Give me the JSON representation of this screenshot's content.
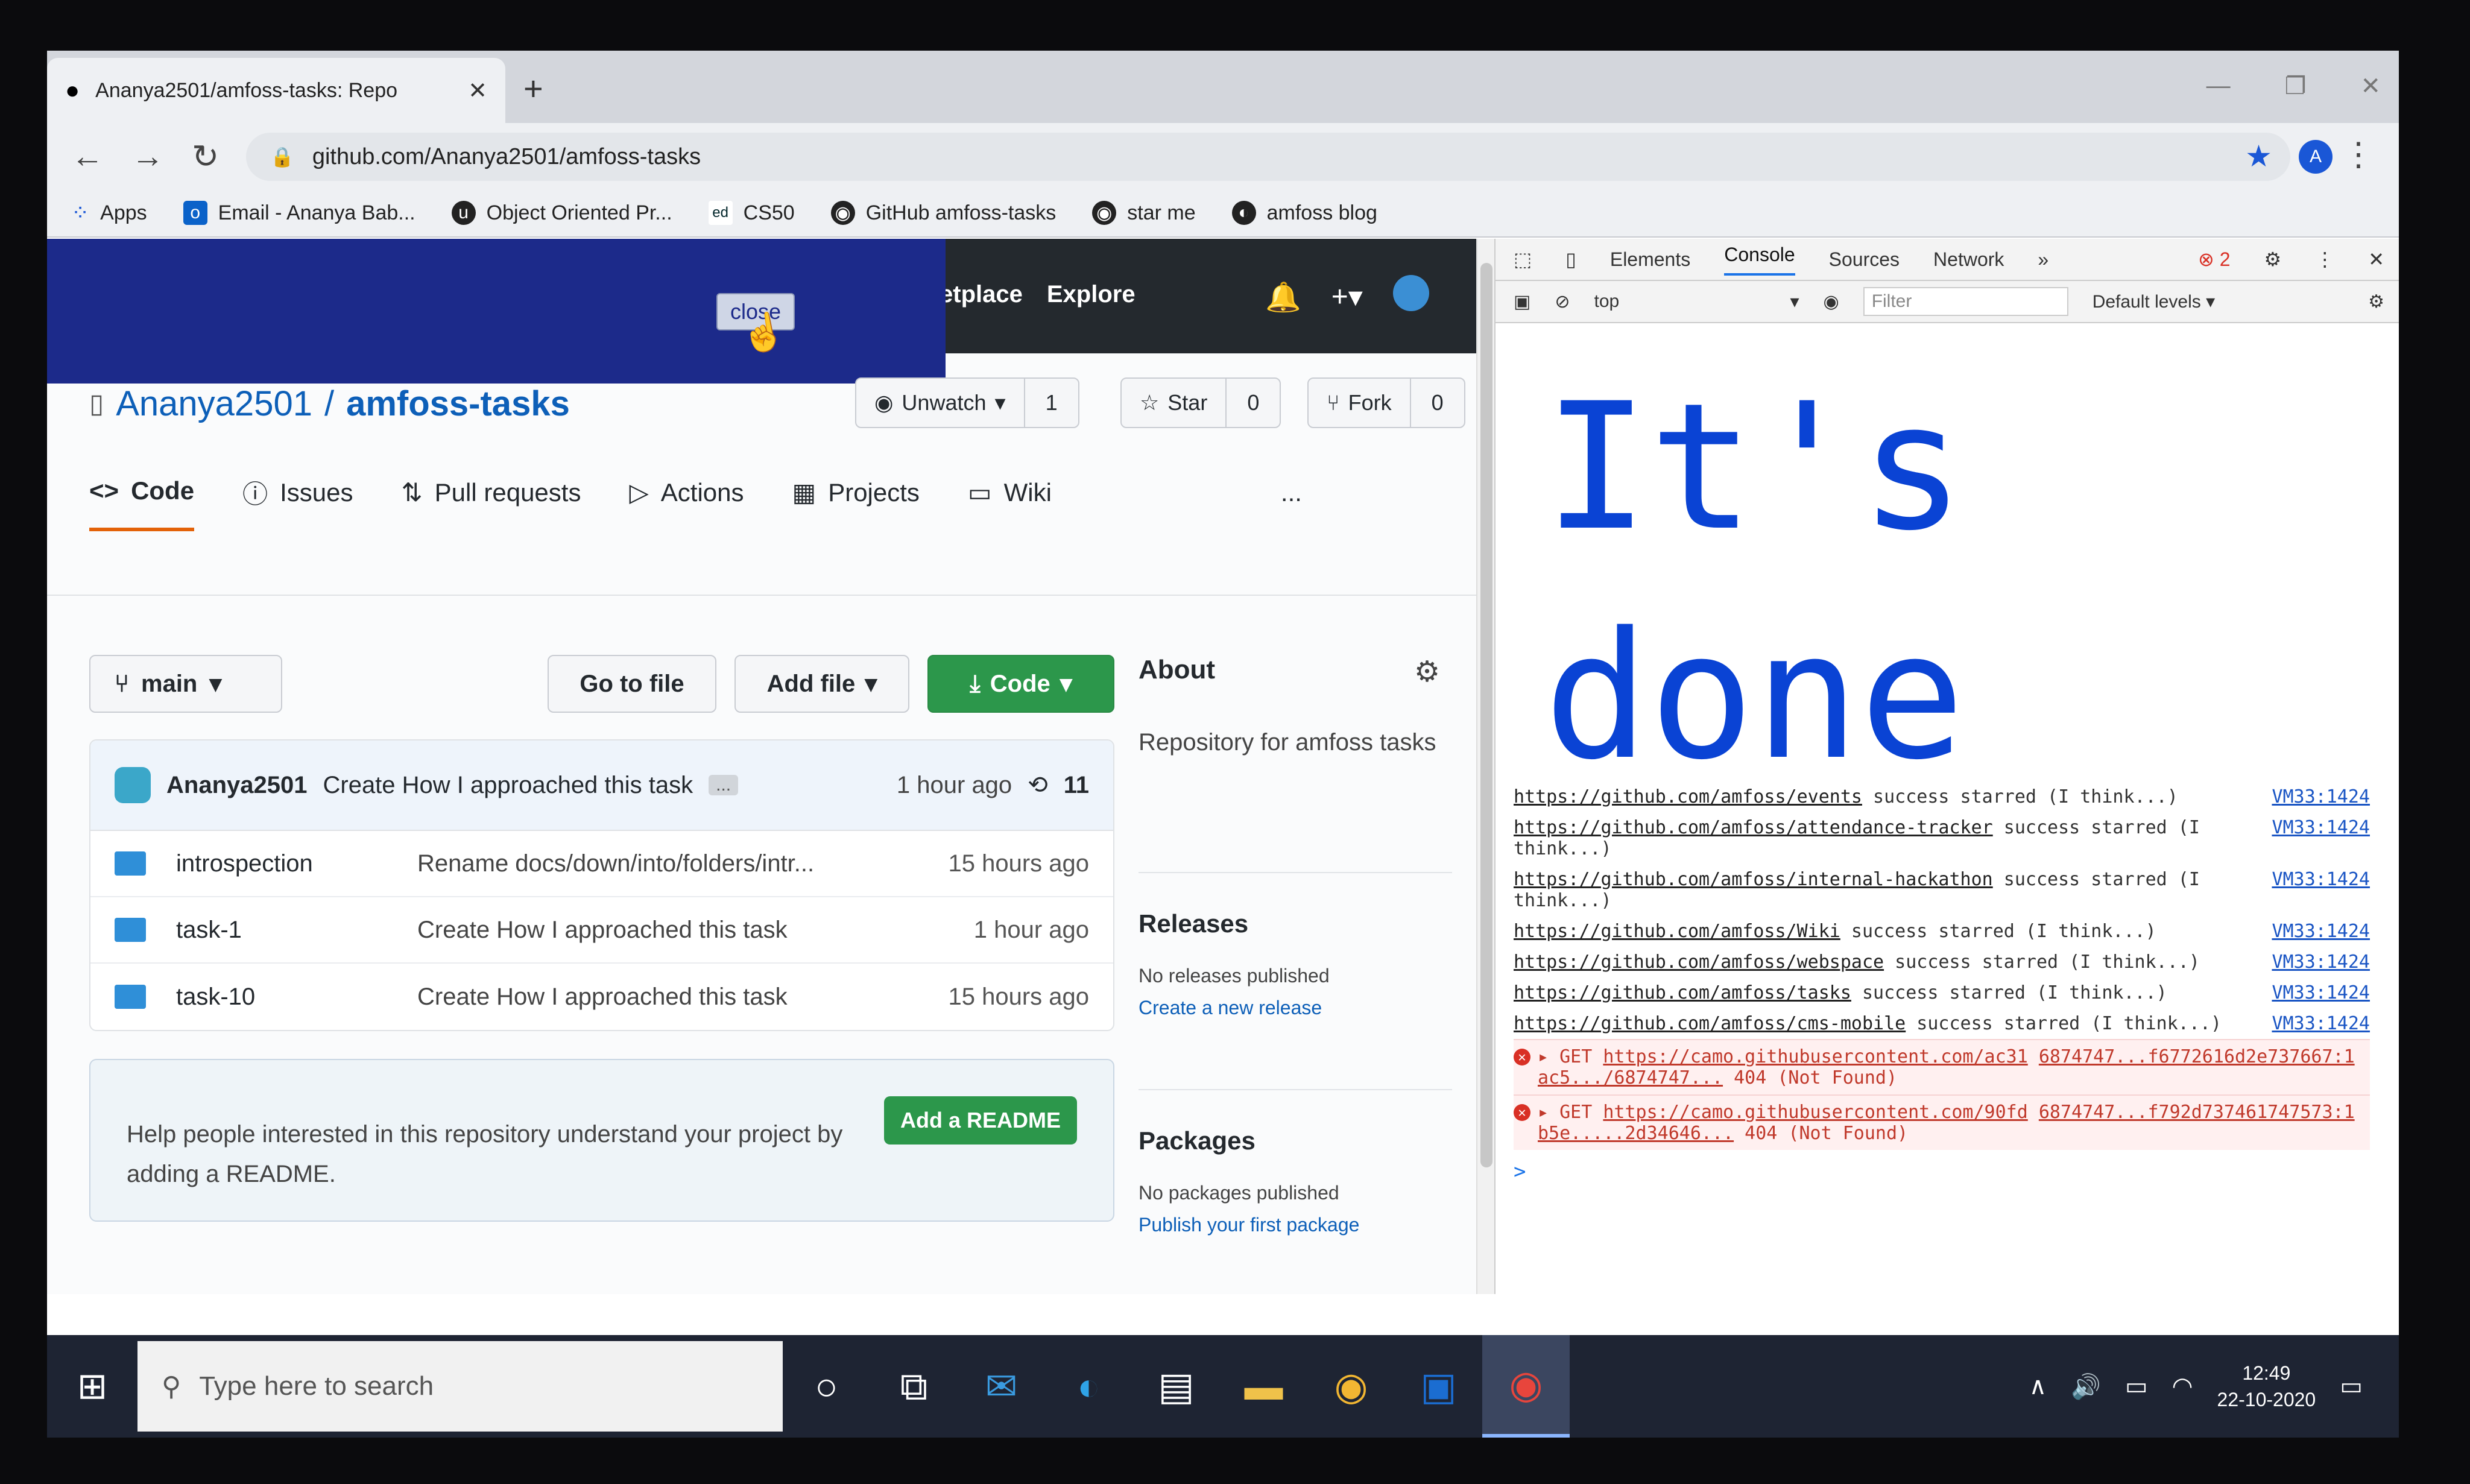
{
  "browser": {
    "tab_title": "Ananya2501/amfoss-tasks: Repo",
    "url": "github.com/Ananya2501/amfoss-tasks",
    "profile_initial": "A",
    "bookmarks": [
      {
        "label": "Apps",
        "icon": "apps-grid-icon"
      },
      {
        "label": "Email - Ananya Bab...",
        "icon": "outlook-icon"
      },
      {
        "label": "Object Oriented Pr...",
        "icon": "udemy-icon"
      },
      {
        "label": "CS50",
        "icon": "edx-icon"
      },
      {
        "label": "GitHub amfoss-tasks",
        "icon": "github-icon"
      },
      {
        "label": "star me",
        "icon": "github-icon"
      },
      {
        "label": "amfoss blog",
        "icon": "blog-icon"
      }
    ]
  },
  "popup": {
    "close_label": "close"
  },
  "header": {
    "menu": [
      "etplace",
      "Explore"
    ]
  },
  "repo": {
    "owner": "Ananya2501",
    "separator": "/",
    "name": "amfoss-tasks",
    "unwatch_label": "Unwatch",
    "watch_count": "1",
    "star_label": "Star",
    "star_count": "0",
    "fork_label": "Fork",
    "fork_count": "0"
  },
  "tabs": [
    {
      "label": "Code",
      "icon": "code-icon"
    },
    {
      "label": "Issues",
      "icon": "issue-icon"
    },
    {
      "label": "Pull requests",
      "icon": "pull-request-icon"
    },
    {
      "label": "Actions",
      "icon": "play-icon"
    },
    {
      "label": "Projects",
      "icon": "project-icon"
    },
    {
      "label": "Wiki",
      "icon": "book-icon"
    }
  ],
  "more_label": "...",
  "file_nav": {
    "branch": "main",
    "go_to_file": "Go to file",
    "add_file": "Add file",
    "code": "Code"
  },
  "commit": {
    "author": "Ananya2501",
    "message": "Create How I approached this task",
    "ellipsis": "...",
    "time": "1 hour ago",
    "count": "11"
  },
  "files": [
    {
      "name": "introspection",
      "message": "Rename docs/down/into/folders/intr...",
      "time": "15 hours ago"
    },
    {
      "name": "task-1",
      "message": "Create How I approached this task",
      "time": "1 hour ago"
    },
    {
      "name": "task-10",
      "message": "Create How I approached this task",
      "time": "15 hours ago"
    }
  ],
  "readme": {
    "text": "Help people interested in this repository understand your project by adding a README.",
    "button": "Add a README"
  },
  "about": {
    "title": "About",
    "description": "Repository for amfoss tasks"
  },
  "releases": {
    "title": "Releases",
    "empty": "No releases published",
    "link": "Create a new release"
  },
  "packages": {
    "title": "Packages",
    "empty": "No packages published",
    "link": "Publish your first package"
  },
  "devtools": {
    "tabs": [
      "Elements",
      "Console",
      "Sources",
      "Network"
    ],
    "more": "»",
    "error_count": "2",
    "context": "top",
    "filter_placeholder": "Filter",
    "levels": "Default levels",
    "big_text": "It's\ndone",
    "logs": [
      {
        "url": "https://github.com/amfoss/events",
        "text": " success starred (I think...)",
        "src": "VM33:1424"
      },
      {
        "url": "https://github.com/amfoss/attendance-tracker",
        "text": " success starred (I think...)",
        "src": "VM33:1424"
      },
      {
        "url": "https://github.com/amfoss/internal-hackathon",
        "text": " success starred (I think...)",
        "src": "VM33:1424"
      },
      {
        "url": "https://github.com/amfoss/Wiki",
        "text": " success starred (I think...)",
        "src": "VM33:1424"
      },
      {
        "url": "https://github.com/amfoss/webspace",
        "text": " success starred (I think...)",
        "src": "VM33:1424"
      },
      {
        "url": "https://github.com/amfoss/tasks",
        "text": " success starred (I think...)",
        "src": "VM33:1424"
      },
      {
        "url": "https://github.com/amfoss/cms-mobile",
        "text": " success starred (I think...)",
        "src": "VM33:1424"
      }
    ],
    "errors": [
      {
        "method": "GET",
        "url": "https://camo.githubusercontent.com/ac31",
        "rest": "6874747...f6772616d2e737667:1",
        "tail": "ac5.../6874747...",
        "status": "404 (Not Found)"
      },
      {
        "method": "GET",
        "url": "https://camo.githubusercontent.com/90fd",
        "rest": "6874747...f792d737461747573:1",
        "tail": "b5e.....2d34646...",
        "status": "404 (Not Found)"
      }
    ],
    "prompt": ">"
  },
  "taskbar": {
    "search_placeholder": "Type here to search",
    "time": "12:49",
    "date": "22-10-2020"
  },
  "colors": {
    "github_green": "#2c974b",
    "link_blue": "#0d5fb8",
    "console_text_blue": "#0a43d4",
    "popup_navy": "#1c2a8a"
  }
}
